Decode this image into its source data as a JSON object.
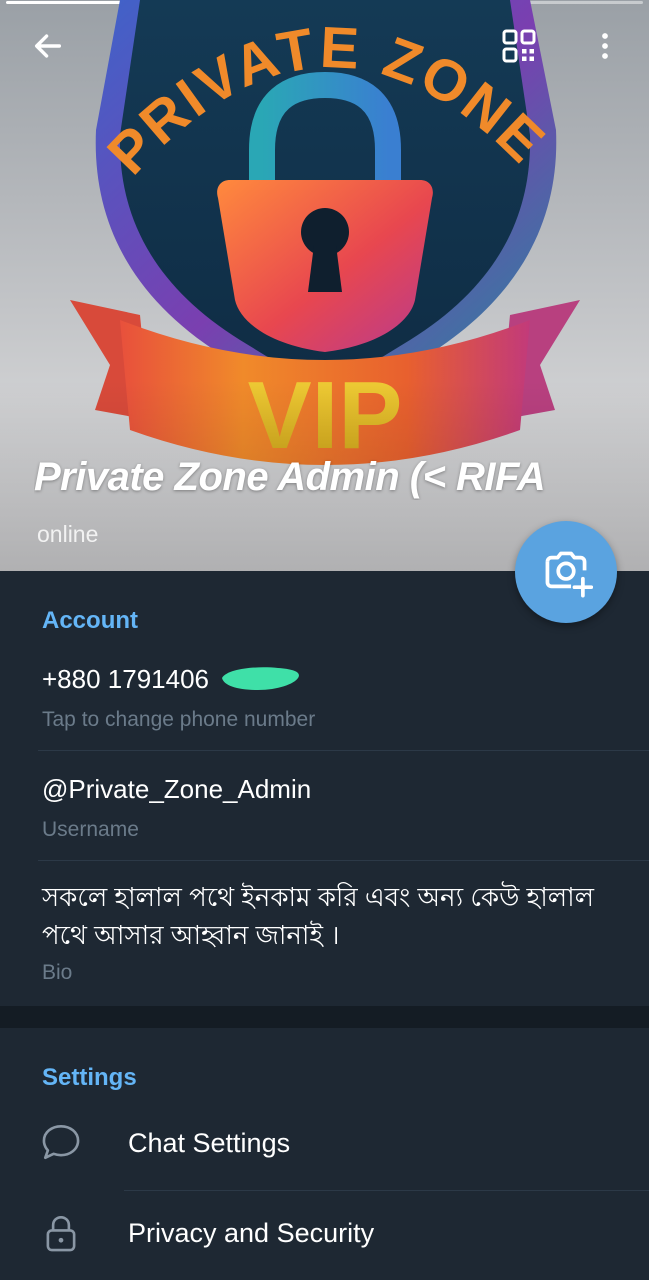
{
  "header": {
    "name": "Private Zone Admin (< RIFA",
    "status": "online",
    "logo_top_text": "PRIVATE ZONE",
    "logo_banner_text": "VIP",
    "icons": {
      "back": "arrow-left-icon",
      "qr": "qr-code-icon",
      "menu": "more-vertical-icon",
      "camera": "camera-add-icon"
    }
  },
  "account": {
    "title": "Account",
    "phone": "+880 1791406",
    "phone_hint": "Tap to change phone number",
    "username": "@Private_Zone_Admin",
    "username_hint": "Username",
    "bio": "সকলে হালাল পথে ইনকাম করি এবং অন্য কেউ হালাল পথে আসার আহ্বান জানাই ।",
    "bio_hint": "Bio"
  },
  "settings": {
    "title": "Settings",
    "items": [
      {
        "label": "Chat Settings",
        "icon": "chat-bubble-icon"
      },
      {
        "label": "Privacy and Security",
        "icon": "lock-icon"
      }
    ]
  },
  "colors": {
    "background": "#1c2733",
    "accent": "#64b5f6",
    "fab": "#5aa3e0",
    "hint": "#6b7b8a"
  }
}
